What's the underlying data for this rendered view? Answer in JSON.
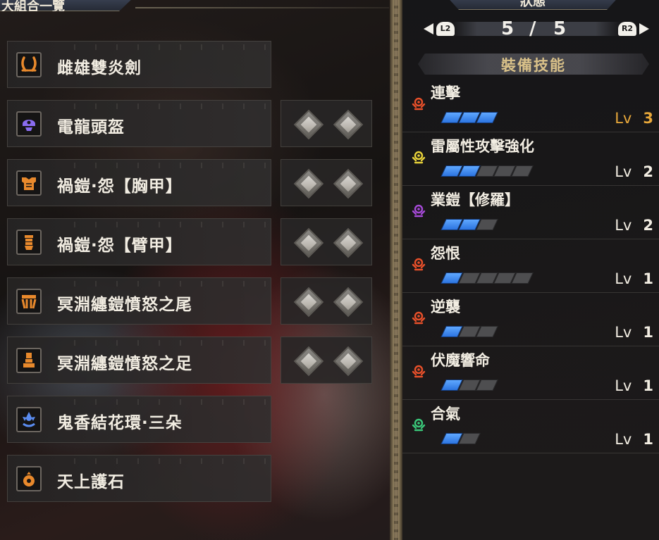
{
  "left_header": {
    "title": "大組合一覽"
  },
  "right_header": {
    "title": "狀態"
  },
  "pager": {
    "left_button": "L2",
    "right_button": "R2",
    "current": "5",
    "separator": "/",
    "total": "5"
  },
  "skills_title": "裝備技能",
  "equipment": [
    {
      "name": "雌雄雙炎劍",
      "icon": "dual-blades-icon",
      "icon_color": "#e8892c",
      "deco_slots": 0
    },
    {
      "name": "電龍頭盔",
      "icon": "helmet-icon",
      "icon_color": "#8a6cf0",
      "deco_slots": 2
    },
    {
      "name": "禍鎧·怨【胸甲】",
      "icon": "chest-armor-icon",
      "icon_color": "#e8892c",
      "deco_slots": 2
    },
    {
      "name": "禍鎧·怨【臂甲】",
      "icon": "arm-armor-icon",
      "icon_color": "#e8892c",
      "deco_slots": 2
    },
    {
      "name": "冥淵纏鎧憤怒之尾",
      "icon": "waist-armor-icon",
      "icon_color": "#e8892c",
      "deco_slots": 2
    },
    {
      "name": "冥淵纏鎧憤怒之足",
      "icon": "leg-armor-icon",
      "icon_color": "#e8892c",
      "deco_slots": 2
    },
    {
      "name": "鬼香結花環·三朵",
      "icon": "charm-flower-icon",
      "icon_color": "#5a8cf0",
      "deco_slots": 0
    },
    {
      "name": "天上護石",
      "icon": "talisman-icon",
      "icon_color": "#e8892c",
      "deco_slots": 0
    }
  ],
  "skills": [
    {
      "name": "連擊",
      "lv_label": "Lv",
      "level": "3",
      "level_value": 3,
      "max_level": 3,
      "icon_color": "#e8502a",
      "maxed": true
    },
    {
      "name": "雷屬性攻擊強化",
      "lv_label": "Lv",
      "level": "2",
      "level_value": 2,
      "max_level": 5,
      "icon_color": "#e8d23a",
      "maxed": false
    },
    {
      "name": "業鎧【修羅】",
      "lv_label": "Lv",
      "level": "2",
      "level_value": 2,
      "max_level": 3,
      "icon_color": "#a64ad8",
      "maxed": false
    },
    {
      "name": "怨恨",
      "lv_label": "Lv",
      "level": "1",
      "level_value": 1,
      "max_level": 5,
      "icon_color": "#e8502a",
      "maxed": false
    },
    {
      "name": "逆襲",
      "lv_label": "Lv",
      "level": "1",
      "level_value": 1,
      "max_level": 3,
      "icon_color": "#e8502a",
      "maxed": false
    },
    {
      "name": "伏魔響命",
      "lv_label": "Lv",
      "level": "1",
      "level_value": 1,
      "max_level": 3,
      "icon_color": "#e8502a",
      "maxed": false
    },
    {
      "name": "合氣",
      "lv_label": "Lv",
      "level": "1",
      "level_value": 1,
      "max_level": 2,
      "icon_color": "#3ac87a",
      "maxed": false
    }
  ]
}
